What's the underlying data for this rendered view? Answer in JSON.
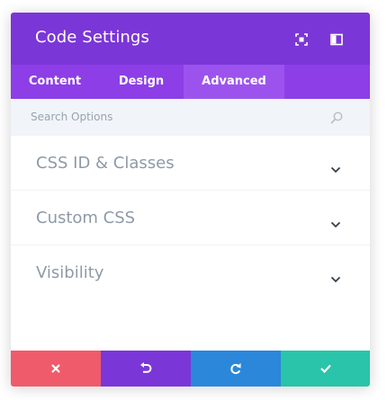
{
  "header": {
    "title": "Code Settings",
    "icons": [
      "fullscreen-icon",
      "sidebar-icon"
    ],
    "background": "#7b36d8"
  },
  "tabs": [
    {
      "label": "Content",
      "active": false
    },
    {
      "label": "Design",
      "active": false
    },
    {
      "label": "Advanced",
      "active": true
    }
  ],
  "search": {
    "placeholder": "Search Options",
    "value": "",
    "icon": "search-icon"
  },
  "sections": [
    {
      "label": "CSS ID & Classes",
      "icon": "chevron-down-icon"
    },
    {
      "label": "Custom CSS",
      "icon": "chevron-down-icon"
    },
    {
      "label": "Visibility",
      "icon": "chevron-down-icon"
    }
  ],
  "footer": {
    "buttons": [
      {
        "name": "discard",
        "icon": "close-icon",
        "color": "#ef5b6b"
      },
      {
        "name": "undo",
        "icon": "undo-icon",
        "color": "#7b36d8"
      },
      {
        "name": "redo",
        "icon": "redo-icon",
        "color": "#2b87da"
      },
      {
        "name": "save",
        "icon": "check-icon",
        "color": "#29c4a9"
      }
    ]
  }
}
